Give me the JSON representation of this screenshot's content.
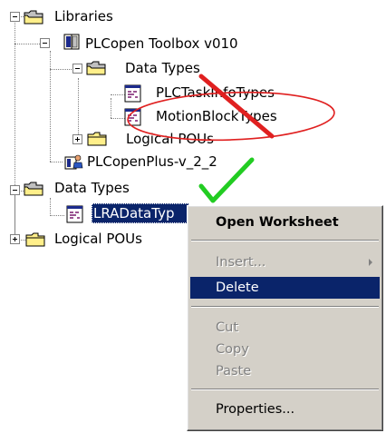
{
  "tree": {
    "libraries_label": "Libraries",
    "toolbox_label": "PLCopen Toolbox v010",
    "toolbox_datatypes_label": "Data Types",
    "plctaskinfotypes_label": "PLCTaskInfoTypes",
    "motionblocktypes_label": "MotionBlockTypes",
    "toolbox_logicalpous_label": "Logical POUs",
    "plcopenplus_label": "PLCopenPlus-v_2_2",
    "datatypes_label": "Data Types",
    "lradatatype_label": "LRADataTyp",
    "logicalpous_label": "Logical POUs"
  },
  "context_menu": {
    "open_worksheet": "Open Worksheet",
    "insert": "Insert...",
    "delete": "Delete",
    "cut": "Cut",
    "copy": "Copy",
    "paste": "Paste",
    "properties": "Properties..."
  },
  "colors": {
    "selection": "#0a246a",
    "menu_bg": "#d4d0c8",
    "annotation_red": "#e02020",
    "annotation_green": "#22cc22"
  },
  "icons": [
    "folder-icon",
    "library-book-icon",
    "datatype-worksheet-icon",
    "library-user-icon"
  ]
}
